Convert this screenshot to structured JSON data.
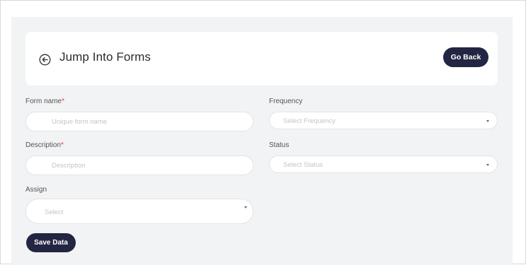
{
  "header": {
    "title": "Jump Into Forms",
    "go_back_label": "Go Back"
  },
  "form": {
    "form_name": {
      "label": "Form name",
      "required_mark": "*",
      "placeholder": "Unique form name",
      "value": ""
    },
    "description": {
      "label": "Description",
      "required_mark": "*",
      "placeholder": "Description",
      "value": ""
    },
    "assign": {
      "label": "Assign",
      "selected": "Select"
    },
    "frequency": {
      "label": "Frequency",
      "selected": "Select Frequency"
    },
    "status": {
      "label": "Status",
      "selected": "Select Status"
    }
  },
  "actions": {
    "save_label": "Save Data"
  },
  "colors": {
    "primary_button": "#232642",
    "required": "#e53935",
    "panel_background": "#f2f3f4"
  }
}
